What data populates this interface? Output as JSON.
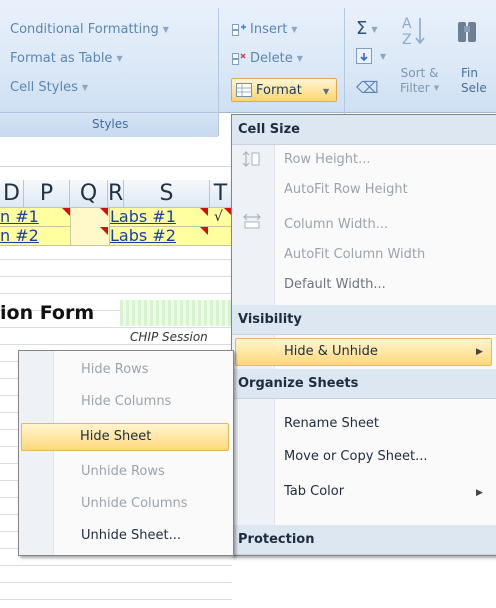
{
  "ribbon": {
    "styles_group": {
      "conditional_formatting": "Conditional Formatting",
      "format_as_table": "Format as Table",
      "cell_styles": "Cell Styles",
      "label": "Styles"
    },
    "cells_group": {
      "insert": "Insert",
      "delete": "Delete",
      "format": "Format"
    },
    "editing_group": {
      "sort_filter_line1": "Sort &",
      "sort_filter_line2": "Filter",
      "find_line1": "Fin",
      "find_line2": "Sele"
    }
  },
  "sheet": {
    "columns": [
      "D",
      "P",
      "Q",
      "R",
      "S",
      "T"
    ],
    "cells": {
      "link1a": "n #1",
      "link1b": "Labs #1",
      "link2a": "n #2",
      "link2b": "Labs #2",
      "check": "√",
      "form_title": "ion Form",
      "chip_session": "CHIP Session"
    }
  },
  "format_menu": {
    "cell_size_header": "Cell Size",
    "row_height": "Row Height...",
    "autofit_row_height": "AutoFit Row Height",
    "column_width": "Column Width...",
    "autofit_column_width": "AutoFit Column Width",
    "default_width": "Default Width...",
    "visibility_header": "Visibility",
    "hide_unhide": "Hide & Unhide",
    "organize_header": "Organize Sheets",
    "rename_sheet": "Rename Sheet",
    "move_copy_sheet": "Move or Copy Sheet...",
    "tab_color": "Tab Color",
    "protection_header": "Protection"
  },
  "hide_submenu": {
    "hide_rows": "Hide Rows",
    "hide_columns": "Hide Columns",
    "hide_sheet": "Hide Sheet",
    "unhide_rows": "Unhide Rows",
    "unhide_columns": "Unhide Columns",
    "unhide_sheet": "Unhide Sheet..."
  },
  "colors": {
    "accent_highlight": "#ffd87a",
    "ribbon_text": "#5a86b3",
    "header_band": "#dde7f2"
  }
}
